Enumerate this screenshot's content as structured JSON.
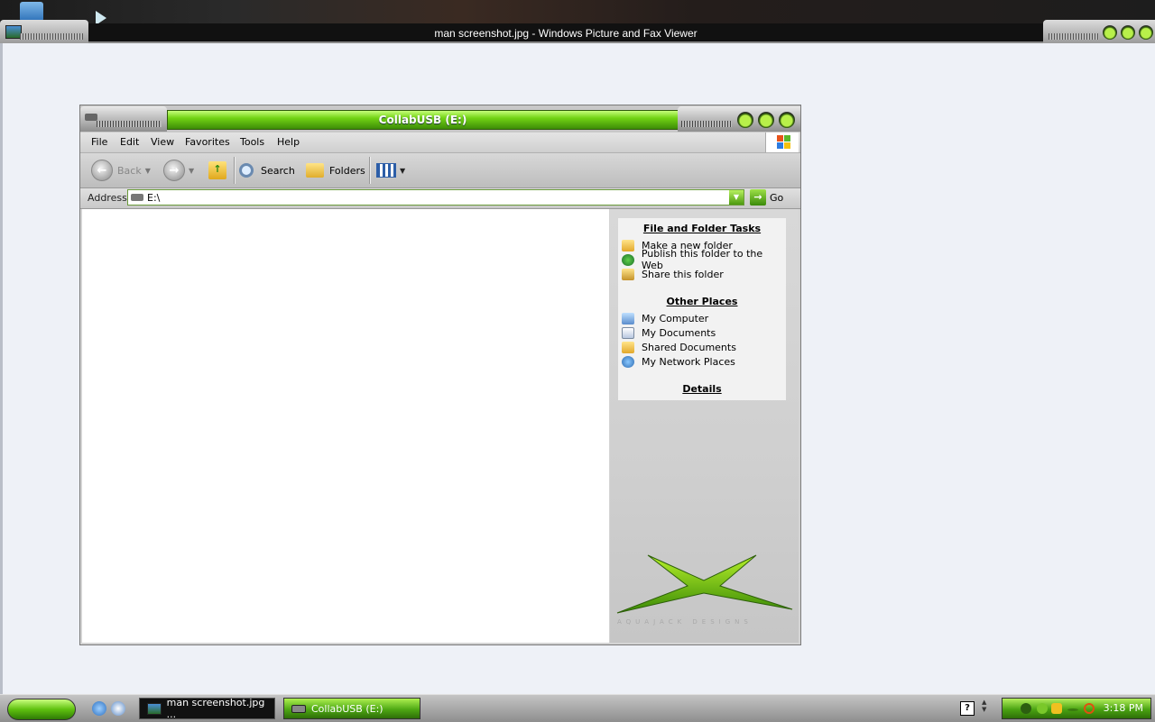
{
  "viewer": {
    "title": "man screenshot.jpg - Windows Picture and Fax Viewer"
  },
  "explorer": {
    "title": "CollabUSB (E:)",
    "menu": [
      "File",
      "Edit",
      "View",
      "Favorites",
      "Tools",
      "Help"
    ],
    "toolbar": {
      "back_label": "Back",
      "search_label": "Search",
      "folders_label": "Folders"
    },
    "address": {
      "label": "Address",
      "value": "E:\\",
      "go_label": "Go"
    },
    "tasks": {
      "file_folder_heading": "File and Folder Tasks",
      "file_folder_items": [
        "Make a new folder",
        "Publish this folder to the Web",
        "Share this folder"
      ],
      "other_places_heading": "Other Places",
      "other_places_items": [
        "My Computer",
        "My Documents",
        "Shared Documents",
        "My Network Places"
      ],
      "details_heading": "Details"
    },
    "brand_text": "AQUAJACK DESIGNS"
  },
  "taskbar": {
    "buttons": [
      "man screenshot.jpg ...",
      "CollabUSB (E:)"
    ],
    "clock": "3:18 PM",
    "help_glyph": "?"
  },
  "colors": {
    "accent_green": "#6ccf12",
    "title_black": "#111111",
    "window_gray": "#d4d4d4"
  }
}
